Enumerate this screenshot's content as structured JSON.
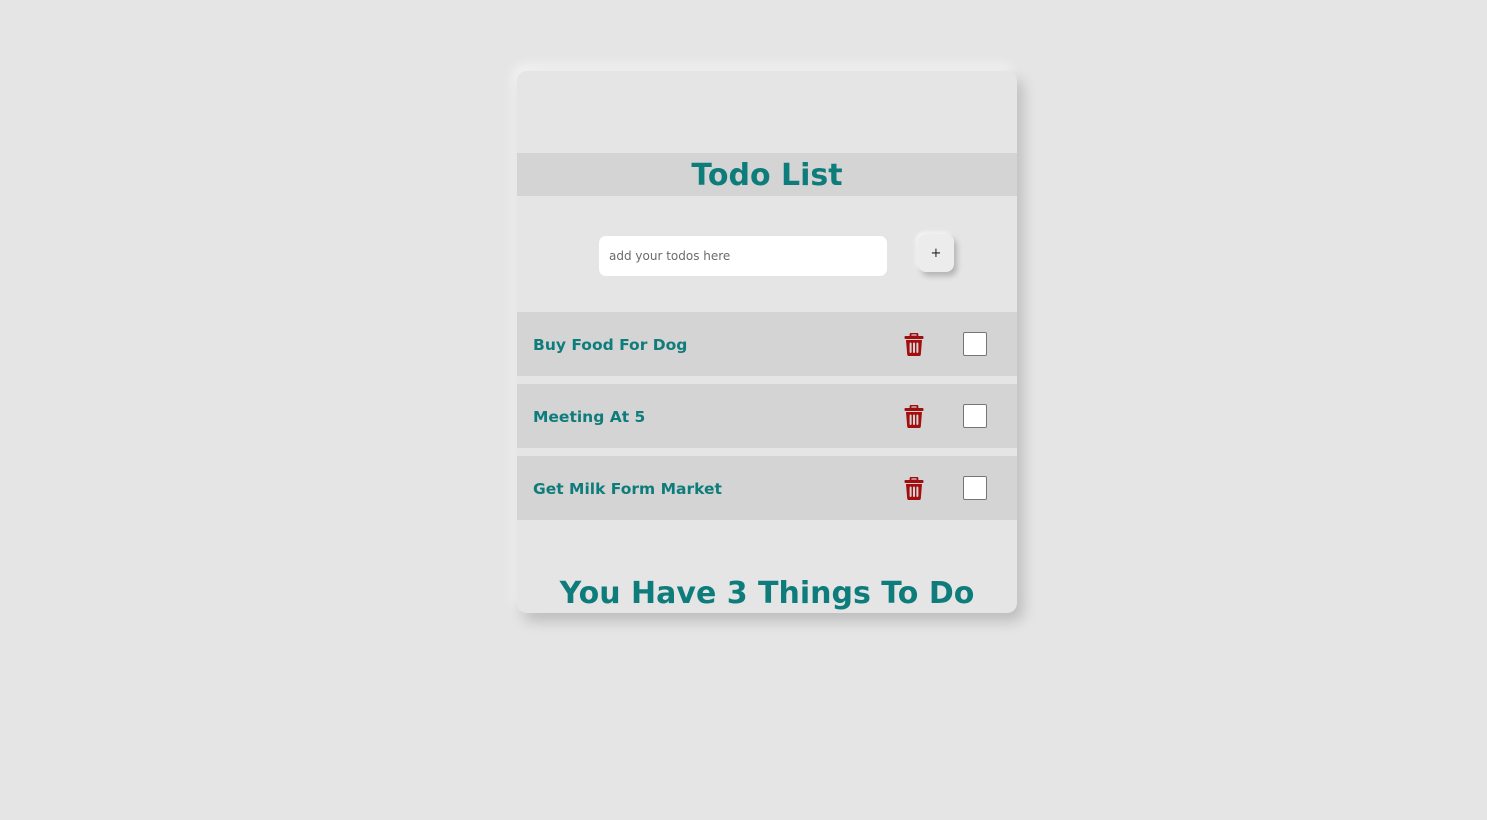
{
  "app": {
    "title": "Todo List"
  },
  "input": {
    "placeholder": "add your todos here",
    "value": "",
    "add_label": "+"
  },
  "todos": [
    {
      "text": "Buy Food For Dog",
      "done": false
    },
    {
      "text": "Meeting At 5",
      "done": false
    },
    {
      "text": "Get Milk Form Market",
      "done": false
    }
  ],
  "summary": {
    "text": "You Have 3 Things To Do"
  },
  "icons": {
    "delete": "trash-icon"
  },
  "colors": {
    "accent": "#0f7c7c",
    "delete": "#a30d0d",
    "background": "#e5e5e5",
    "row": "#d4d4d4"
  }
}
